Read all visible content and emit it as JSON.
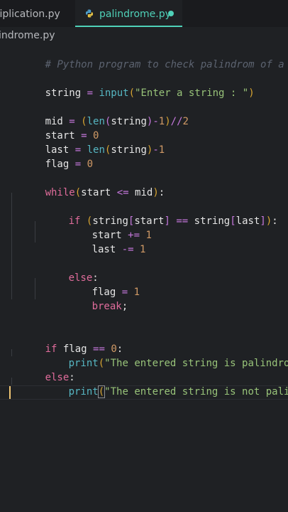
{
  "tabs": [
    {
      "label": "tiplication.py",
      "active": false
    },
    {
      "label": "palindrome.py",
      "active": true,
      "icon": "python-icon",
      "modified": true
    }
  ],
  "breadcrumb": "indrome.py",
  "colors": {
    "accent": "#4fd1b8",
    "comment": "#5c6370",
    "keyword": "#e06c9b",
    "function": "#56b6c2",
    "string": "#98c379",
    "number": "#d19a66",
    "operator": "#c678dd",
    "paren": "#d7a431"
  },
  "code": {
    "l1": "# Python program to check palindrom of a string",
    "l3": {
      "a": "string",
      "b": " = ",
      "c": "input",
      "d": "(",
      "e": "\"Enter a string : \"",
      "f": ")"
    },
    "l5": {
      "a": "mid",
      "b": " = ",
      "c": "(",
      "d": "len",
      "e": "(",
      "f": "string",
      "g": ")",
      "h": "-",
      "i": "1",
      "j": ")",
      "k": "//",
      "l": "2"
    },
    "l6": {
      "a": "start",
      "b": " = ",
      "c": "0"
    },
    "l7": {
      "a": "last",
      "b": " = ",
      "c": "len",
      "d": "(",
      "e": "string",
      "f": ")",
      "g": "-",
      "h": "1"
    },
    "l8": {
      "a": "flag",
      "b": " = ",
      "c": "0"
    },
    "l10": {
      "a": "while",
      "b": "(",
      "c": "start",
      "d": " <= ",
      "e": "mid",
      "f": ")",
      "g": ":"
    },
    "l12": {
      "a": "if",
      "b": " ",
      "c": "(",
      "d": "string",
      "e": "[",
      "f": "start",
      "g": "]",
      "h": " == ",
      "i": "string",
      "j": "[",
      "k": "last",
      "l": "]",
      "m": ")",
      "n": ":"
    },
    "l13": {
      "a": "start",
      "b": " += ",
      "c": "1"
    },
    "l14": {
      "a": "last",
      "b": " -= ",
      "c": "1"
    },
    "l16": {
      "a": "else",
      "b": ":"
    },
    "l17": {
      "a": "flag",
      "b": " = ",
      "c": "1"
    },
    "l18": {
      "a": "break",
      "b": ";"
    },
    "l21": {
      "a": "if",
      "b": " flag ",
      "c": "==",
      "d": " ",
      "e": "0",
      "f": ":"
    },
    "l22": {
      "a": "print",
      "b": "(",
      "c": "\"The entered string is palindrome\"",
      "d": ")"
    },
    "l23": {
      "a": "else",
      "b": ":"
    },
    "l24": {
      "a": "print",
      "b": "(",
      "c": "\"The entered string is not palindrome\"",
      "d": ")"
    }
  }
}
